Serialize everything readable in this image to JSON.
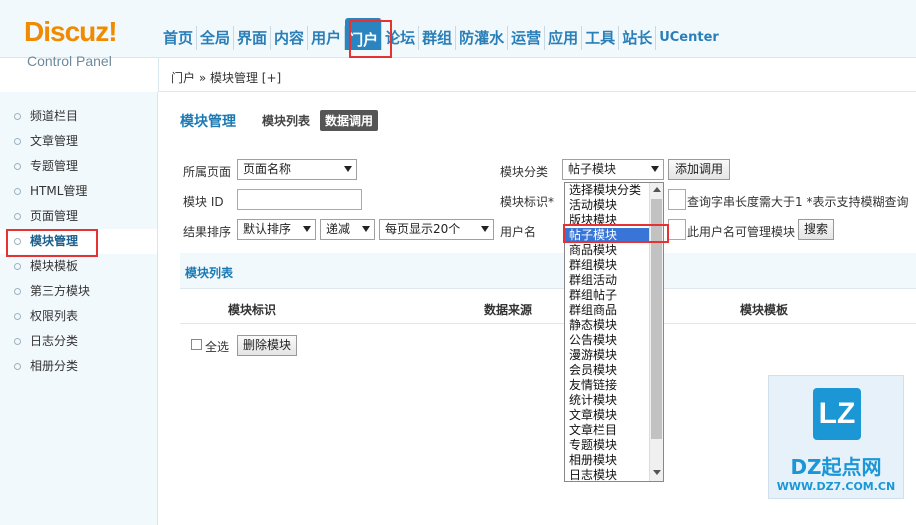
{
  "header": {
    "brand": "Discuz!",
    "subtitle": "Control Panel",
    "nav": [
      "首页",
      "全局",
      "界面",
      "内容",
      "用户",
      "门户",
      "论坛",
      "群组",
      "防灌水",
      "运营",
      "应用",
      "工具",
      "站长",
      "UCenter"
    ],
    "active_nav": "门户"
  },
  "breadcrumb": "门户 » 模块管理 [+]",
  "sidebar": {
    "items": [
      "频道栏目",
      "文章管理",
      "专题管理",
      "HTML管理",
      "页面管理",
      "模块管理",
      "模块模板",
      "第三方模块",
      "权限列表",
      "日志分类",
      "相册分类"
    ],
    "active": "模块管理"
  },
  "main": {
    "title": "模块管理",
    "tabs": [
      "模块列表",
      "数据调用"
    ],
    "active_tab": "数据调用",
    "form": {
      "page_label": "所属页面",
      "page_value": "页面名称",
      "category_label": "模块分类",
      "category_value": "帖子模块",
      "add_button": "添加调用",
      "id_label": "模块 ID",
      "mark_label": "模块标识*",
      "hint": "查询字串长度需大于1  *表示支持模糊查询",
      "sort_label": "结果排序",
      "sort_value": "默认排序",
      "order_value": "递减",
      "perpage_value": "每页显示20个",
      "user_label": "用户名",
      "user_hint": "此用户名可管理模块",
      "search_button": "搜索"
    },
    "list": {
      "title": "模块列表",
      "columns": [
        "模块标识",
        "数据来源",
        "模块模板"
      ],
      "select_all": "全选",
      "delete_button": "删除模块"
    }
  },
  "dropdown": {
    "options": [
      "选择模块分类",
      "活动模块",
      "版块模块",
      "帖子模块",
      "商品模块",
      "群组模块",
      "群组活动",
      "群组帖子",
      "群组商品",
      "静态模块",
      "公告模块",
      "漫游模块",
      "会员模块",
      "友情链接",
      "统计模块",
      "文章模块",
      "文章栏目",
      "专题模块",
      "相册模块",
      "日志模块"
    ],
    "selected": "帖子模块"
  },
  "watermark": {
    "logo": "LZ",
    "name": "DZ起点网",
    "url": "WWW.DZ7.COM.CN"
  }
}
